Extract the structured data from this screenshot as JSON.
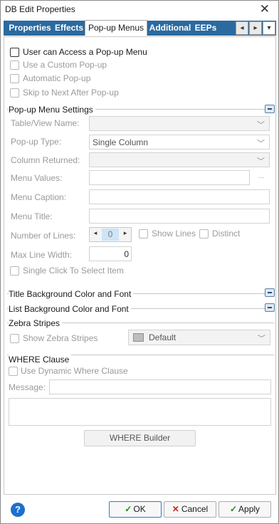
{
  "window": {
    "title": "DB Edit Properties",
    "close": "✕"
  },
  "tabs": [
    {
      "label": "Properties"
    },
    {
      "label": "Effects"
    },
    {
      "label": "Pop-up Menus"
    },
    {
      "label": "Additional"
    },
    {
      "label": "EEPs"
    }
  ],
  "tab_nav": {
    "left": "◂",
    "right": "▸",
    "menu": "▾"
  },
  "access": {
    "user_can_access": "User can Access a Pop-up Menu",
    "use_custom": "Use a Custom Pop-up",
    "automatic": "Automatic Pop-up",
    "skip_next": "Skip to Next After Pop-up"
  },
  "settings": {
    "title": "Pop-up Menu Settings",
    "table_view_label": "Table/View Name:",
    "popup_type_label": "Pop-up Type:",
    "popup_type_value": "Single Column",
    "column_returned_label": "Column Returned:",
    "menu_values_label": "Menu Values:",
    "menu_values_ellipsis": "...",
    "menu_caption_label": "Menu Caption:",
    "menu_title_label": "Menu Title:",
    "number_of_lines_label": "Number of Lines:",
    "number_of_lines_value": "0",
    "show_lines": "Show Lines",
    "distinct": "Distinct",
    "max_line_width_label": "Max Line Width:",
    "max_line_width_value": "0",
    "single_click": "Single Click To Select Item"
  },
  "title_bg": {
    "label": "Title Background Color and Font"
  },
  "list_bg": {
    "label": "List Background Color and Font"
  },
  "zebra": {
    "title": "Zebra Stripes",
    "show_label": "Show Zebra Stripes",
    "color_value": "Default"
  },
  "where": {
    "title": "WHERE Clause",
    "dynamic": "Use Dynamic Where Clause",
    "message_label": "Message:",
    "builder": "WHERE Builder"
  },
  "footer": {
    "help": "?",
    "ok": "OK",
    "cancel": "Cancel",
    "apply": "Apply"
  },
  "colors": {
    "tab_bar": "#2b6aa0",
    "accent": "#1e6fce",
    "zebra_swatch": "#bdbdbd"
  },
  "icons": [
    "close-icon",
    "chevron-left-icon",
    "chevron-right-icon",
    "chevron-down-icon",
    "collapse-icon",
    "help-icon",
    "checkmark-icon",
    "x-icon"
  ]
}
